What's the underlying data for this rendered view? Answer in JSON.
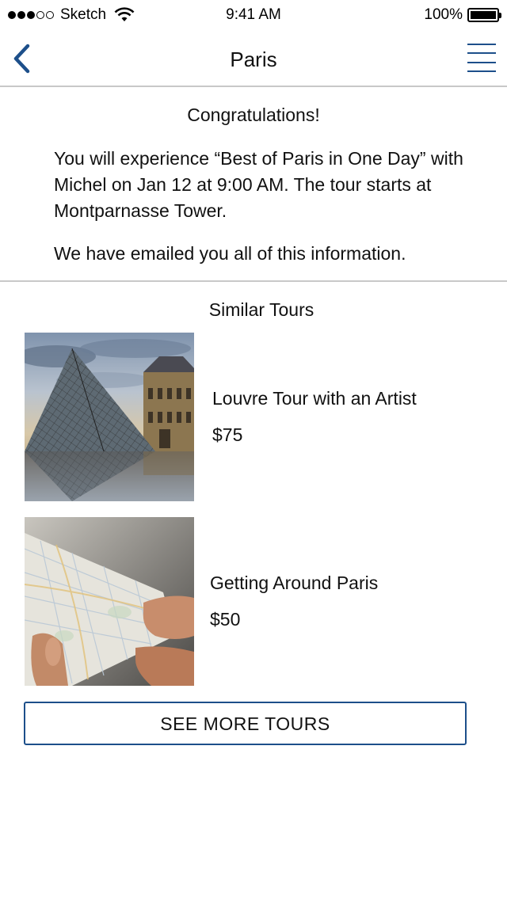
{
  "status_bar": {
    "carrier": "Sketch",
    "time": "9:41 AM",
    "battery": "100%",
    "signal_bars_filled": 3,
    "signal_bars_total": 5
  },
  "nav": {
    "title": "Paris",
    "back_icon": "chevron-left-icon",
    "menu_icon": "hamburger-menu-icon"
  },
  "confirmation": {
    "heading": "Congratulations!",
    "body": "You will experience “Best of Paris in One Day” with Michel on Jan 12 at 9:00 AM. The tour starts at Montparnasse Tower.",
    "email_note": "We have emailed you all of this information."
  },
  "similar": {
    "heading": "Similar Tours",
    "tours": [
      {
        "name": "Louvre Tour with an Artist",
        "price": "$75"
      },
      {
        "name": "Getting Around Paris",
        "price": "$50"
      }
    ]
  },
  "see_more_label": "SEE MORE TOURS",
  "colors": {
    "accent": "#1d4f8a",
    "divider": "#c8c8c8"
  }
}
